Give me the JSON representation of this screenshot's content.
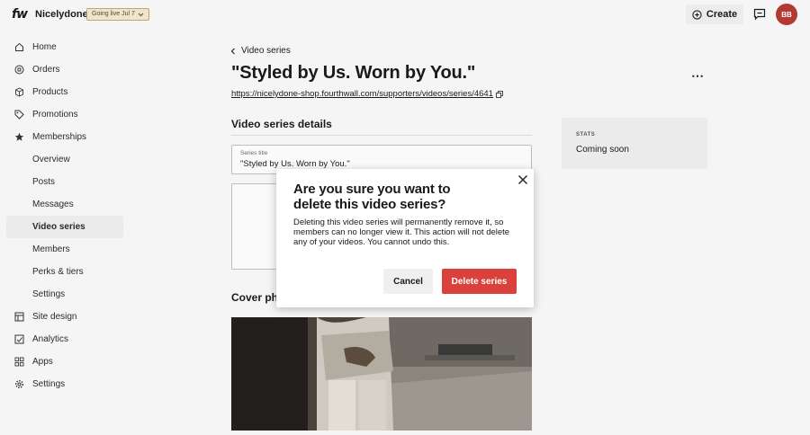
{
  "topbar": {
    "logo": "fw",
    "store_name": "Nicelydone",
    "golive_badge": "Going live Jul 7",
    "create_label": "Create",
    "avatar_initials": "BB",
    "avatar_color": "#b23a32"
  },
  "sidebar": {
    "items": [
      {
        "label": "Home",
        "icon": "home-icon"
      },
      {
        "label": "Orders",
        "icon": "orders-icon"
      },
      {
        "label": "Products",
        "icon": "products-icon"
      },
      {
        "label": "Promotions",
        "icon": "tag-icon"
      },
      {
        "label": "Memberships",
        "icon": "star-icon"
      },
      {
        "label": "Overview"
      },
      {
        "label": "Posts"
      },
      {
        "label": "Messages"
      },
      {
        "label": "Video series",
        "active": true
      },
      {
        "label": "Members"
      },
      {
        "label": "Perks & tiers"
      },
      {
        "label": "Settings"
      },
      {
        "label": "Site design",
        "icon": "site-design-icon"
      },
      {
        "label": "Analytics",
        "icon": "analytics-icon"
      },
      {
        "label": "Apps",
        "icon": "apps-icon"
      },
      {
        "label": "Settings",
        "icon": "gear-icon"
      }
    ]
  },
  "main": {
    "breadcrumb": "Video series",
    "title": "\"Styled by Us. Worn by You.\"",
    "url": "https://nicelydone-shop.fourthwall.com/supporters/videos/series/4641",
    "details_heading": "Video series details",
    "series_title_label": "Series title",
    "series_title_value": "\"Styled by Us. Worn by You.\"",
    "cover_heading": "Cover photo"
  },
  "stats": {
    "label": "STATS",
    "value": "Coming soon"
  },
  "modal": {
    "title": "Are you sure you want to delete this video series?",
    "body": "Deleting this video series will permanently remove it, so members can no longer view it. This action will not delete any of your videos. You cannot undo this.",
    "cancel_label": "Cancel",
    "delete_label": "Delete series",
    "delete_color": "#d9413a"
  }
}
